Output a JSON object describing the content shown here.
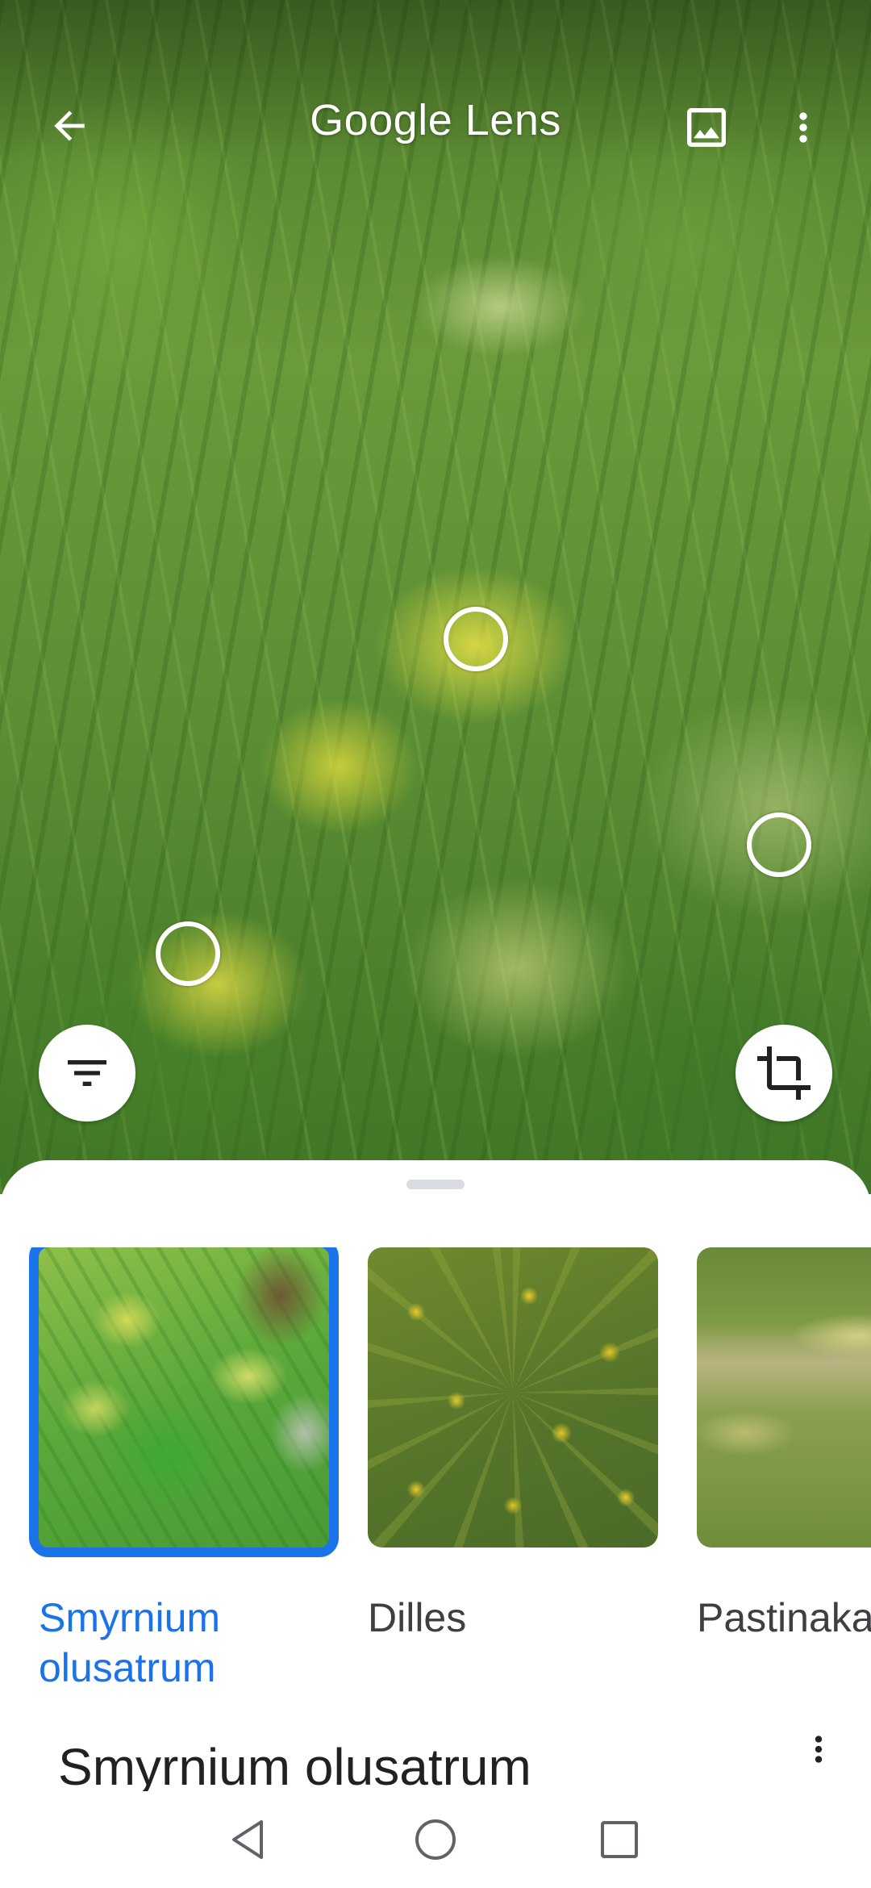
{
  "app": {
    "title_brand": "Google",
    "title_product": "Lens"
  },
  "header": {
    "back_icon": "arrow-left-icon",
    "gallery_icon": "image-icon",
    "menu_icon": "more-vert-icon"
  },
  "camera": {
    "filter_icon": "filter-icon",
    "crop_icon": "crop-icon",
    "focus_points": 3
  },
  "results": {
    "items": [
      {
        "label": "Smyrnium olusatrum",
        "selected": true
      },
      {
        "label": "Dilles",
        "selected": false
      },
      {
        "label": "Pastinaka",
        "selected": false
      }
    ]
  },
  "detail": {
    "title": "Smyrnium olusatrum",
    "more_icon": "more-vert-icon"
  },
  "navbar": {
    "back_icon": "nav-back-icon",
    "home_icon": "nav-home-icon",
    "recents_icon": "nav-recents-icon"
  },
  "colors": {
    "accent": "#1a73e8",
    "text_primary": "#202124",
    "text_secondary": "#3c4043"
  }
}
